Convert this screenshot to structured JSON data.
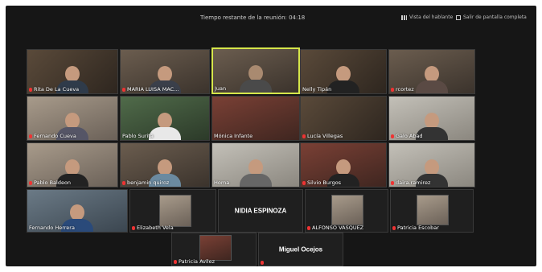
{
  "meeting": {
    "timer_text": "Tiempo restante de la reunión: 04:18"
  },
  "controls": {
    "gallery_label": "Vista del hablante",
    "fullscreen_label": "Salir de pantalla completa"
  },
  "participants": {
    "rita": "Rita De La Cueva",
    "maria": "MARIA LUISA MAC...",
    "juan": "Juan",
    "nelly": "Nelly Tipán",
    "rcortez": "rcortez",
    "fernando_c": "Fernando Cueva",
    "pablo_s": "Pablo Surita",
    "monica": "Mónica Infante",
    "lucia": "Lucía Villegas",
    "galo": "Galo Abad",
    "pablo_b": "Pablo Baldeon",
    "benjamin": "benjamin quiroz",
    "homa": "Homa",
    "silvio": "Silvio Burgos",
    "daira": "daira.ramirez",
    "fernando_h": "Fernando Herrera",
    "elizabeth": "Elizabeth Vela",
    "nidia": "NIDIA ESPINOZA",
    "alfonso": "ALFONSO VASQUEZ",
    "patricia_e": "Patricia Escobar",
    "patricia_a": "Patricia Avilez",
    "miguel": "Miguel Ocejos"
  },
  "icons": {
    "muted": "mic-muted-icon",
    "gallery": "gallery-view-icon",
    "fullscreen": "exit-fullscreen-icon"
  }
}
